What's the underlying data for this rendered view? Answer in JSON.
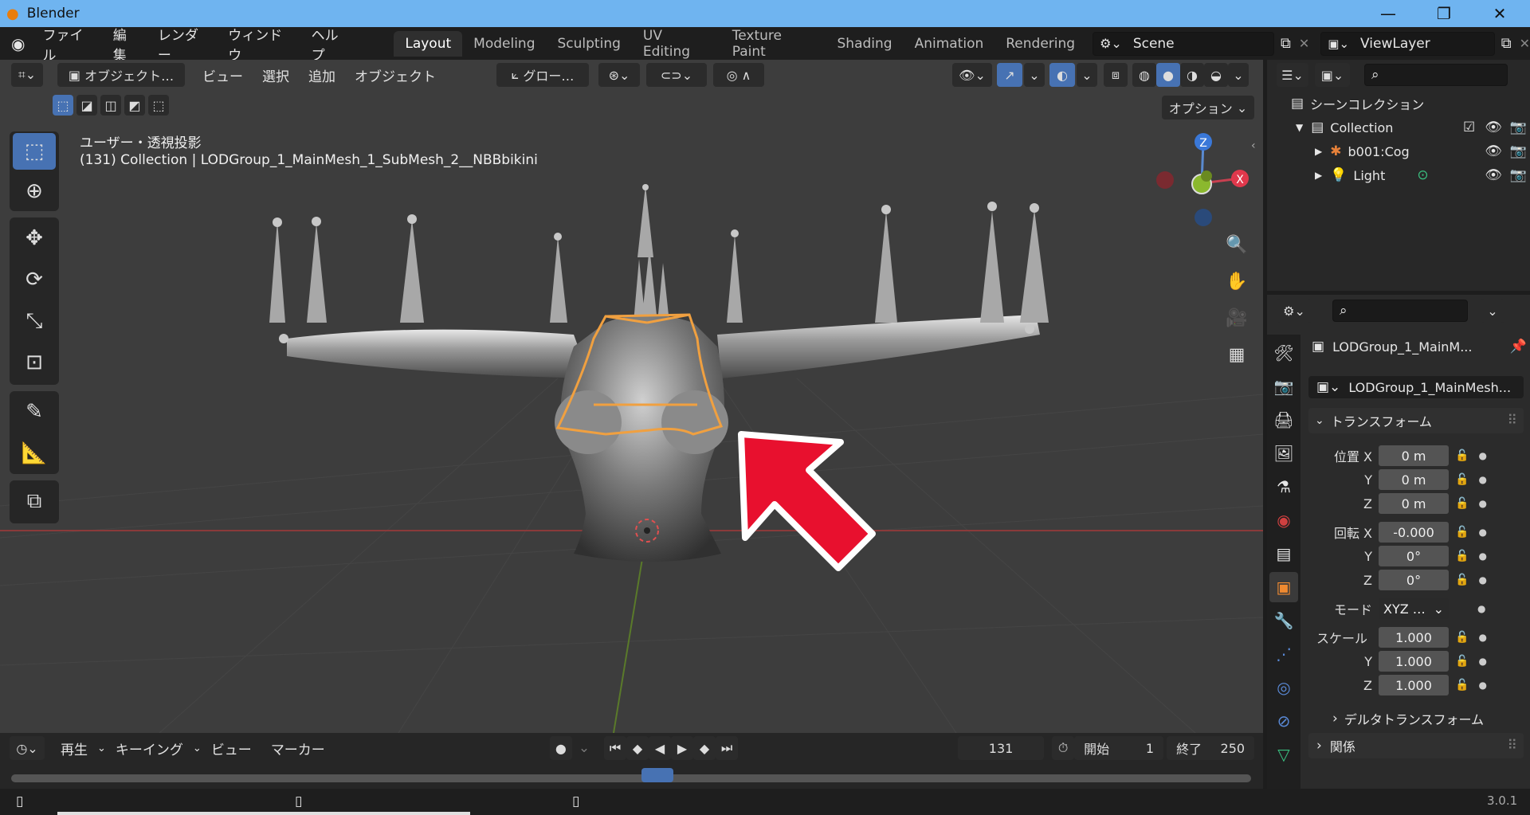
{
  "window": {
    "title": "Blender",
    "minimize": "—",
    "maximize": "❐",
    "close": "✕"
  },
  "menu": {
    "file": "ファイル",
    "edit": "編集",
    "render": "レンダー",
    "window": "ウィンドウ",
    "help": "ヘルプ"
  },
  "workspaces": [
    "Layout",
    "Modeling",
    "Sculpting",
    "UV Editing",
    "Texture Paint",
    "Shading",
    "Animation",
    "Rendering"
  ],
  "active_workspace": "Layout",
  "scene": {
    "name": "Scene"
  },
  "viewlayer": {
    "name": "ViewLayer"
  },
  "viewport_header": {
    "mode": "オブジェクト…",
    "view": "ビュー",
    "select": "選択",
    "add": "追加",
    "object": "オブジェクト",
    "transform_orientation": "グロー…",
    "options": "オプション"
  },
  "viewport_overlay": {
    "view_name": "ユーザー・透視投影",
    "info": "(131) Collection | LODGroup_1_MainMesh_1_SubMesh_2__NBBbikini"
  },
  "gizmo": {
    "z": "Z",
    "x": "X"
  },
  "outliner": {
    "scene_collection": "シーンコレクション",
    "items": [
      {
        "label": "Collection",
        "indent": 1
      },
      {
        "label": "b001:Cog",
        "indent": 2
      },
      {
        "label": "Light",
        "indent": 2
      }
    ]
  },
  "properties": {
    "object_name": "LODGroup_1_MainM...",
    "data_name": "LODGroup_1_MainMesh...",
    "transform_title": "トランスフォーム",
    "location_label": "位置 X",
    "loc": [
      "0 m",
      "0 m",
      "0 m"
    ],
    "rotation_label": "回転 X",
    "rot": [
      "-0.000",
      "0°",
      "0°"
    ],
    "mode_label": "モード",
    "mode_value": "XYZ …",
    "scale_label": "スケール",
    "scale": [
      "1.000",
      "1.000",
      "1.000"
    ],
    "y": "Y",
    "z": "Z",
    "delta_transform": "デルタトランスフォーム",
    "relations": "関係"
  },
  "timeline": {
    "playback": "再生",
    "keying": "キーイング",
    "view": "ビュー",
    "marker": "マーカー",
    "current_frame": "131",
    "start_label": "開始",
    "start": "1",
    "end_label": "終了",
    "end": "250"
  },
  "status": {
    "version": "3.0.1"
  },
  "colors": {
    "accent": "#4772b3",
    "selection": "#f0a040",
    "arrow": "#e8102e"
  }
}
